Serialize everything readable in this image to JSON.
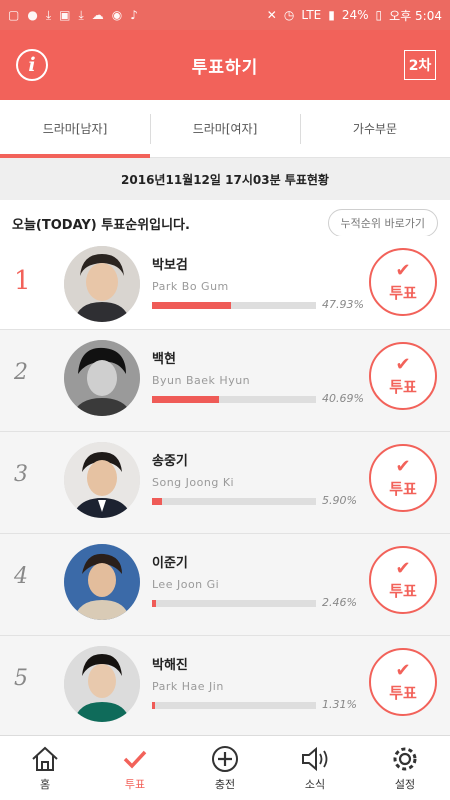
{
  "status_bar": {
    "network": "LTE",
    "battery": "24%",
    "time": "오후 5:04",
    "icons": [
      "chat-icon",
      "app-icon",
      "download-icon",
      "gallery-icon",
      "download-icon",
      "cloud-icon",
      "talk-icon",
      "microphone-icon",
      "mute-icon",
      "alarm-icon",
      "signal-icon",
      "battery-icon"
    ]
  },
  "header": {
    "title": "투표하기",
    "info_icon": "info-icon",
    "round_label": "2차"
  },
  "tabs": [
    {
      "label": "드라마[남자]",
      "active": true
    },
    {
      "label": "드라마[여자]",
      "active": false
    },
    {
      "label": "가수부문",
      "active": false
    }
  ],
  "date_banner": "2016년11월12일 17시03분 투표현황",
  "ranking": {
    "title": "오늘(TODAY) 투표순위입니다.",
    "cumulative_button": "누적순위 바로가기"
  },
  "candidates": [
    {
      "rank": "1",
      "name_ko": "박보검",
      "name_en": "Park Bo Gum",
      "percent_label": "47.93%",
      "percent": 47.93
    },
    {
      "rank": "2",
      "name_ko": "백현",
      "name_en": "Byun Baek Hyun",
      "percent_label": "40.69%",
      "percent": 40.69
    },
    {
      "rank": "3",
      "name_ko": "송중기",
      "name_en": "Song Joong Ki",
      "percent_label": "5.90%",
      "percent": 5.9
    },
    {
      "rank": "4",
      "name_ko": "이준기",
      "name_en": "Lee Joon Gi",
      "percent_label": "2.46%",
      "percent": 2.46
    },
    {
      "rank": "5",
      "name_ko": "박해진",
      "name_en": "Park Hae Jin",
      "percent_label": "1.31%",
      "percent": 1.31
    }
  ],
  "vote_label": "투표",
  "bottom_nav": [
    {
      "label": "홈",
      "icon": "home-icon",
      "active": false
    },
    {
      "label": "투표",
      "icon": "check-icon",
      "active": true
    },
    {
      "label": "충전",
      "icon": "plus-circle-icon",
      "active": false
    },
    {
      "label": "소식",
      "icon": "speaker-icon",
      "active": false
    },
    {
      "label": "설정",
      "icon": "gear-icon",
      "active": false
    }
  ],
  "colors": {
    "accent": "#f2625a",
    "bar": "#ef5b57",
    "track": "#dedede"
  }
}
